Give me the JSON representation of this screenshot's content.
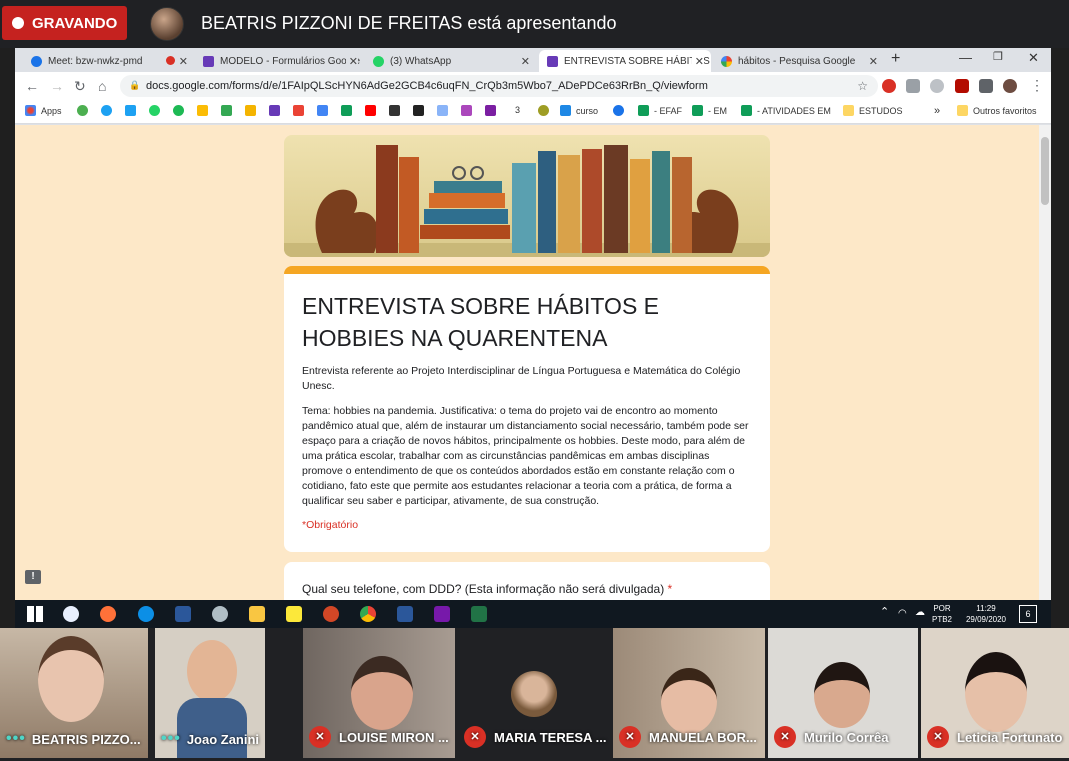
{
  "meet": {
    "recording_label": "GRAVANDO",
    "presenter_text": "BEATRIS PIZZONI DE FREITAS está apresentando"
  },
  "browser": {
    "tabs": [
      {
        "title": "Meet: bzw-nwkz-pmd",
        "color": "#1a73e8"
      },
      {
        "title": "MODELO - Formulários Google",
        "color": "#673ab7"
      },
      {
        "title": "(3) WhatsApp",
        "color": "#25d366"
      },
      {
        "title": "ENTREVISTA SOBRE HÁBITOS E",
        "color": "#673ab7"
      },
      {
        "title": "hábitos - Pesquisa Google",
        "color": "#4285f4"
      }
    ],
    "new_tab": "+",
    "url": "docs.google.com/forms/d/e/1FAIpQLScHYN6AdGe2GCB4c6uqFN_CrQb3m5Wbo7_ADePDCe63RrBn_Q/viewform",
    "bookmarks": [
      "Apps",
      "3",
      "curso",
      "- EFAF",
      "- EM",
      "- ATIVIDADES EM",
      "ESTUDOS"
    ],
    "bookmarks_more": "»",
    "other_bookmarks": "Outros favoritos"
  },
  "form": {
    "title": "ENTREVISTA SOBRE HÁBITOS E HOBBIES NA QUARENTENA",
    "description_1": "Entrevista referente ao Projeto Interdisciplinar de Língua Portuguesa e Matemática do Colégio Unesc.",
    "description_2": "Tema: hobbies na pandemia. Justificativa: o tema do projeto vai de encontro ao momento pandêmico atual que, além de instaurar um distanciamento social necessário, também pode ser espaço para a criação de novos hábitos, principalmente os hobbies. Deste modo, para além de uma prática escolar, trabalhar com as circunstâncias pandêmicas em ambas disciplinas promove o entendimento de que os conteúdos abordados estão em constante relação com o cotidiano, fato este que permite aos estudantes relacionar a teoria com a prática, de forma a qualificar seu saber e participar, ativamente, de sua construção.",
    "required_note": "*Obrigatório",
    "question_1": "Qual seu telefone, com DDD? (Esta informação não será divulgada)",
    "required_mark": "*"
  },
  "taskbar": {
    "lang": "POR",
    "layout": "PTB2",
    "time": "11:29",
    "date": "29/09/2020",
    "notifications": "6"
  },
  "participants": [
    {
      "name": "BEATRIS PIZZO...",
      "muted": false,
      "bg": "#a08a78"
    },
    {
      "name": "Joao Zanini",
      "muted": false,
      "bg": "#c9c2b8"
    },
    {
      "name": "LOUISE MIRON ...",
      "muted": true,
      "bg": "#8a8078"
    },
    {
      "name": "MARIA TERESA ...",
      "muted": true,
      "bg": "#202124"
    },
    {
      "name": "MANUELA BOR...",
      "muted": true,
      "bg": "#b7a89a"
    },
    {
      "name": "Murilo Corrêa",
      "muted": true,
      "bg": "#d8d6d2"
    },
    {
      "name": "Leticia Fortunato",
      "muted": true,
      "bg": "#d9d2c8"
    }
  ]
}
